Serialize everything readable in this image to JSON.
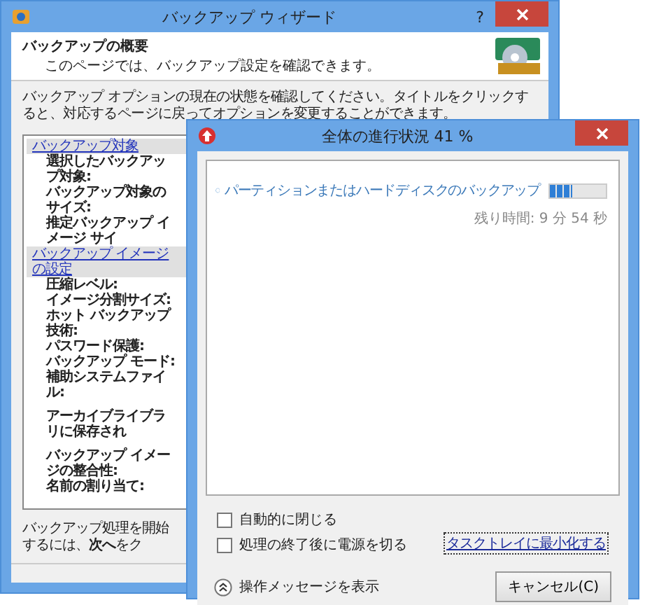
{
  "back_window": {
    "title": "バックアップ ウィザード",
    "help_button": "?",
    "header": {
      "title": "バックアップの概要",
      "subtitle": "このページでは、バックアップ設定を確認できます。"
    },
    "intro": "バックアップ オプションの現在の状態を確認してください。タイトルをクリックすると、対応するページに戻ってオプションを変更することができます。",
    "summary_list": [
      {
        "kind": "section",
        "text": "バックアップ対象"
      },
      {
        "kind": "item",
        "text": "選択したバックアップ対象:"
      },
      {
        "kind": "item",
        "text": "バックアップ対象のサイズ:"
      },
      {
        "kind": "item",
        "text": "推定バックアップ イメージ サイ"
      },
      {
        "kind": "section",
        "text": "バックアップ イメージの設定"
      },
      {
        "kind": "item",
        "text": "圧縮レベル:"
      },
      {
        "kind": "item",
        "text": "イメージ分割サイズ:"
      },
      {
        "kind": "item",
        "text": "ホット バックアップ技術:"
      },
      {
        "kind": "item",
        "text": "パスワード保護:"
      },
      {
        "kind": "item",
        "text": "バックアップ モード:"
      },
      {
        "kind": "item",
        "text": "補助システムファイル:"
      },
      {
        "kind": "spacer"
      },
      {
        "kind": "item",
        "text": "アーカイブライブラリに保存され"
      },
      {
        "kind": "spacer"
      },
      {
        "kind": "item",
        "text": "バックアップ イメージの整合性:"
      },
      {
        "kind": "item",
        "text": "名前の割り当て:"
      }
    ],
    "footer_text": "バックアップ処理を開始するには、**次へ**をク"
  },
  "progress_window": {
    "title": "全体の進行状況 41 %",
    "task": {
      "label": "パーティションまたはハードディスクのバックアップ",
      "level": 0.41,
      "remaining": "残り時間: 9 分 54 秒"
    },
    "options": [
      {
        "label": "自動的に閉じる",
        "checked": false
      },
      {
        "label": "処理の終了後に電源を切る",
        "checked": false
      }
    ],
    "minimize_link": "タスクトレイに最小化する",
    "details_toggle": "操作メッセージを表示",
    "cancel_button": "キャンセル(C)"
  }
}
